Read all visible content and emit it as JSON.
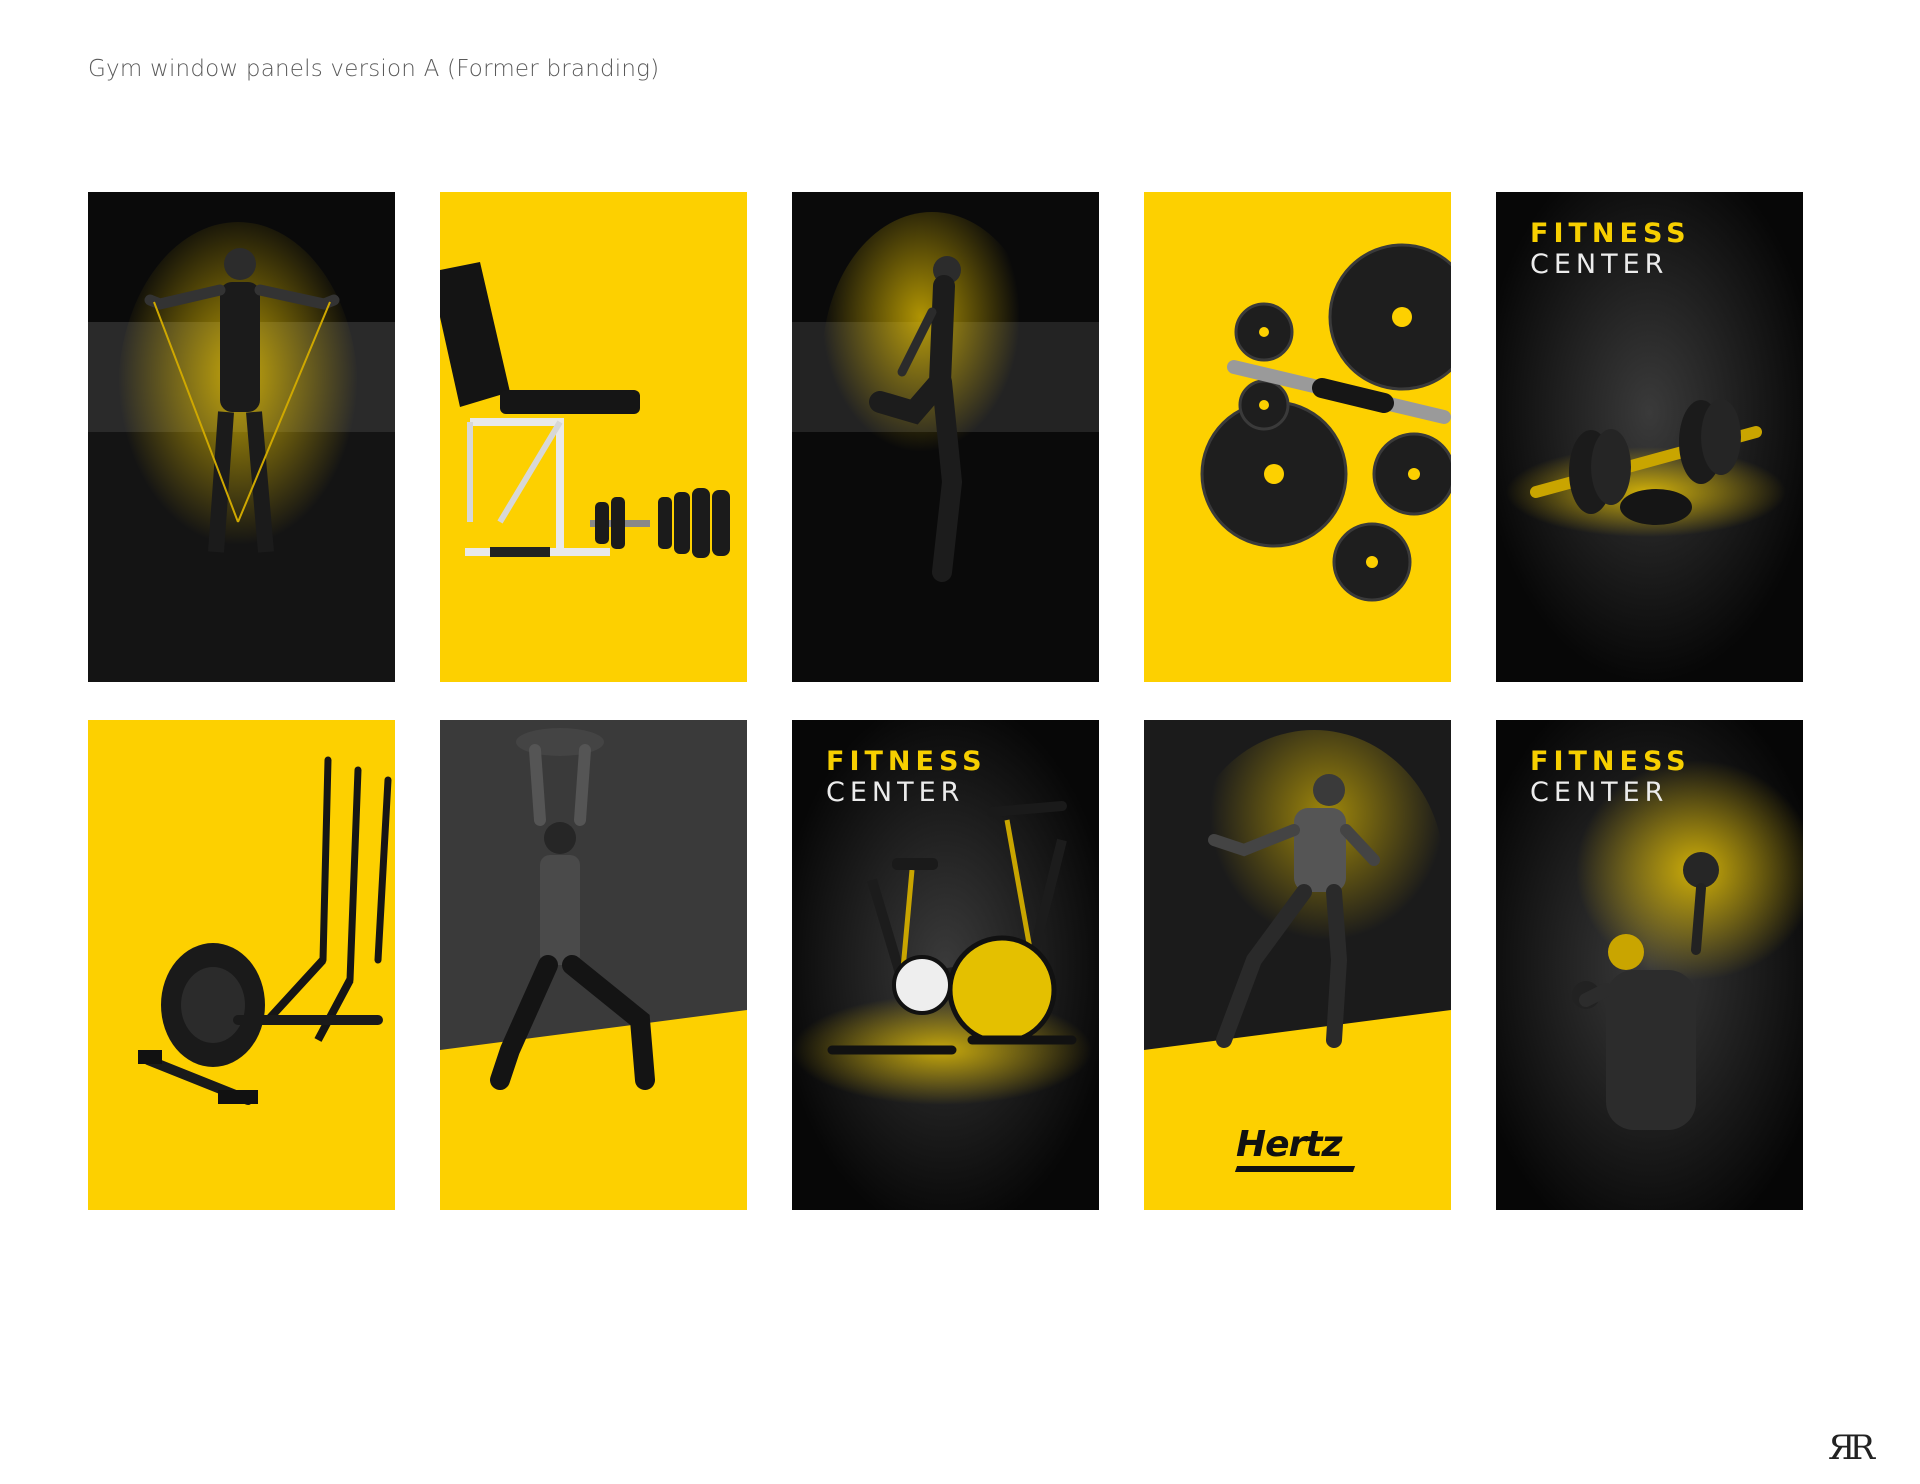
{
  "page": {
    "title": "Gym window panels version A (Former branding)",
    "monogram": "ЯR"
  },
  "colors": {
    "brand_yellow": "#fdd000",
    "panel_black": "#0b0b0b",
    "title_gray": "#5a5a5a"
  },
  "panels": {
    "fitness_center": {
      "line1": "FITNESS",
      "line2": "CENTER"
    },
    "hertz_logo": "Hertz"
  }
}
